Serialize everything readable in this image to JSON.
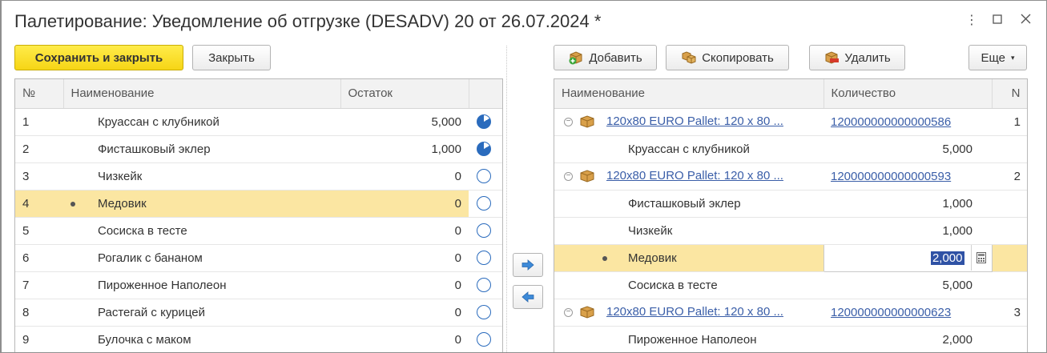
{
  "window": {
    "title": "Палетирование: Уведомление об отгрузке (DESADV) 20 от 26.07.2024 *"
  },
  "toolbar_left": {
    "save_close": "Сохранить и закрыть",
    "close": "Закрыть"
  },
  "toolbar_right": {
    "add": "Добавить",
    "copy": "Скопировать",
    "delete": "Удалить",
    "more": "Еще"
  },
  "left_table": {
    "headers": {
      "no": "№",
      "name": "Наименование",
      "rest": "Остаток"
    },
    "rows": [
      {
        "no": "1",
        "name": "Круассан с клубникой",
        "rest": "5,000",
        "status": "part"
      },
      {
        "no": "2",
        "name": "Фисташковый эклер",
        "rest": "1,000",
        "status": "part"
      },
      {
        "no": "3",
        "name": "Чизкейк",
        "rest": "0",
        "status": "empty"
      },
      {
        "no": "4",
        "name": "Медовик",
        "rest": "0",
        "status": "empty"
      },
      {
        "no": "5",
        "name": "Сосиска в тесте",
        "rest": "0",
        "status": "empty"
      },
      {
        "no": "6",
        "name": "Рогалик с бананом",
        "rest": "0",
        "status": "empty"
      },
      {
        "no": "7",
        "name": "Пироженное Наполеон",
        "rest": "0",
        "status": "empty"
      },
      {
        "no": "8",
        "name": "Растегай с курицей",
        "rest": "0",
        "status": "empty"
      },
      {
        "no": "9",
        "name": "Булочка с маком",
        "rest": "0",
        "status": "empty"
      }
    ]
  },
  "right_table": {
    "headers": {
      "name": "Наименование",
      "qty": "Количество",
      "n": "N"
    },
    "rows": [
      {
        "kind": "pallet",
        "name": "120x80 EURO Pallet:   120 x 80 ...",
        "code": "120000000000000586",
        "n": "1"
      },
      {
        "kind": "item",
        "name": "Круассан с клубникой",
        "qty": "5,000"
      },
      {
        "kind": "pallet",
        "name": "120x80 EURO Pallet:   120 x 80 ...",
        "code": "120000000000000593",
        "n": "2"
      },
      {
        "kind": "item",
        "name": "Фисташковый эклер",
        "qty": "1,000"
      },
      {
        "kind": "item",
        "name": "Чизкейк",
        "qty": "1,000"
      },
      {
        "kind": "item",
        "name": "Медовик",
        "qty": "2,000",
        "editing": true
      },
      {
        "kind": "item",
        "name": "Сосиска в тесте",
        "qty": "5,000"
      },
      {
        "kind": "pallet",
        "name": "120x80 EURO Pallet:   120 x 80 ...",
        "code": "120000000000000623",
        "n": "3"
      },
      {
        "kind": "item",
        "name": "Пироженное Наполеон",
        "qty": "2,000"
      }
    ]
  },
  "colors": {
    "accent_yellow": "#f6d516",
    "selection": "#fbe6a2",
    "link": "#3a5ea8",
    "status_blue": "#2a6bbd"
  }
}
